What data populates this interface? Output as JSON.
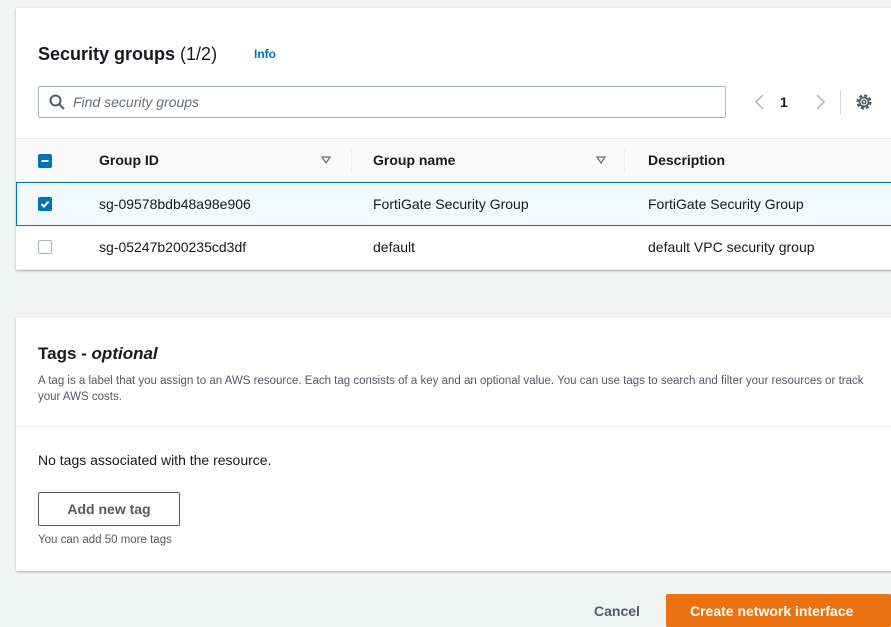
{
  "security_groups": {
    "title": "Security groups",
    "count": "(1/2)",
    "info_link": "Info",
    "search": {
      "placeholder": "Find security groups",
      "value": ""
    },
    "pagination": {
      "current_page": "1",
      "prev_icon": "chevron-left-icon",
      "next_icon": "chevron-right-icon"
    },
    "settings_icon": "gear-icon",
    "columns": [
      "Group ID",
      "Group name",
      "Description"
    ],
    "header_checkbox_state": "indeterminate",
    "rows": [
      {
        "selected": true,
        "group_id": "sg-09578bdb48a98e906",
        "group_name": "FortiGate Security Group",
        "description": "FortiGate Security Group"
      },
      {
        "selected": false,
        "group_id": "sg-05247b200235cd3df",
        "group_name": "default",
        "description": "default VPC security group"
      }
    ]
  },
  "tags": {
    "title": "Tags -",
    "title_optional": "optional",
    "description": "A tag is a label that you assign to an AWS resource. Each tag consists of a key and an optional value. You can use tags to search and filter your resources or track your AWS costs.",
    "empty_message": "No tags associated with the resource.",
    "add_button": "Add new tag",
    "limit_text": "You can add 50 more tags"
  },
  "footer": {
    "cancel_label": "Cancel",
    "create_label": "Create network interface"
  },
  "colors": {
    "primary_action": "#ec7211",
    "link": "#0073bb",
    "selected_row_bg": "#f1faff",
    "page_bg": "#f2f3f3"
  }
}
